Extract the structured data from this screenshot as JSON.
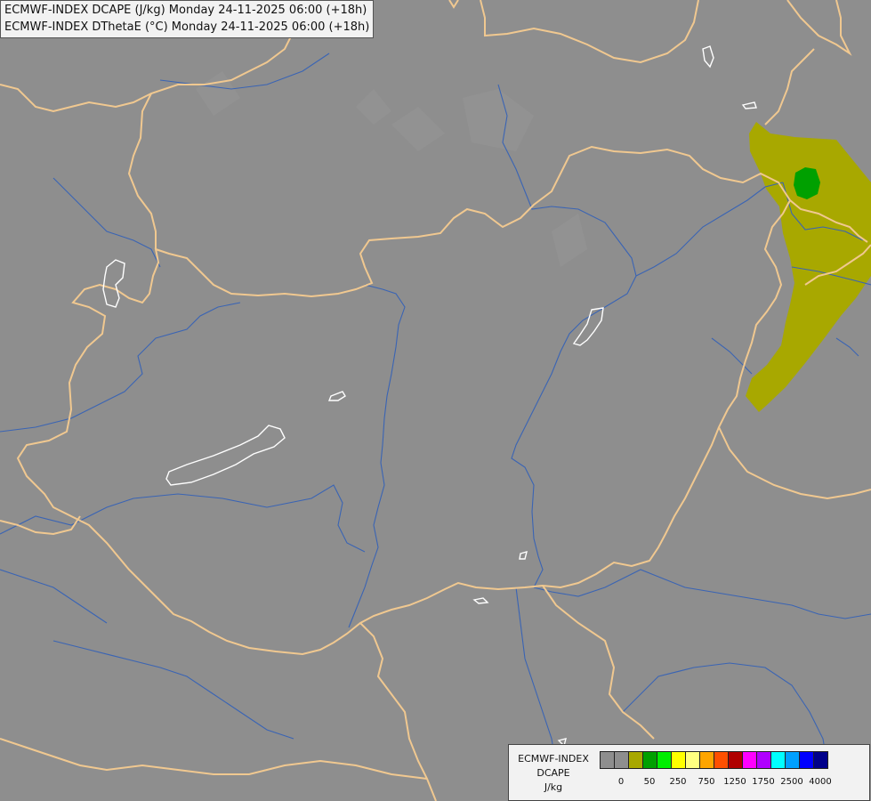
{
  "title": {
    "line1": "ECMWF-INDEX DCAPE (J/kg) Monday 24-11-2025 06:00 (+18h)",
    "line2": "ECMWF-INDEX DThetaE (°C) Monday 24-11-2025 06:00 (+18h)"
  },
  "legend": {
    "name_line1": "ECMWF-INDEX",
    "name_line2": "DCAPE",
    "unit": "J/kg",
    "colors": [
      "#8e8e8e",
      "#8e8e8e",
      "#a8a800",
      "#00a000",
      "#00ee00",
      "#ffff00",
      "#ffff80",
      "#ffa500",
      "#ff5000",
      "#b00000",
      "#ff00ff",
      "#b000ff",
      "#00ffff",
      "#00a0ff",
      "#0000ff",
      "#00008b"
    ],
    "ticks": [
      "0",
      "50",
      "250",
      "750",
      "1250",
      "1750",
      "2500",
      "4000"
    ]
  },
  "map": {
    "colors": {
      "background": "#8e8e8e",
      "border": "#f0c890",
      "river": "#3a64b4",
      "lake": "#ffffff",
      "dcape_50": "#a8a800",
      "dcape_250": "#00a000"
    }
  }
}
